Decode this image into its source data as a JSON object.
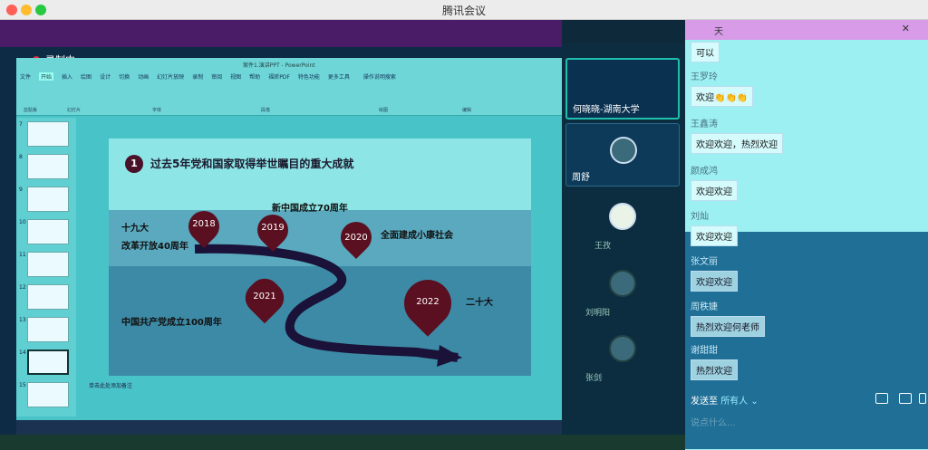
{
  "window": {
    "title": "腾讯会议"
  },
  "recording": {
    "label": "录制中"
  },
  "powerpoint": {
    "title": "案件1.演讲PPT - PowerPoint",
    "tabs": [
      "文件",
      "开始",
      "插入",
      "绘图",
      "设计",
      "切换",
      "动画",
      "幻灯片放映",
      "录制",
      "审阅",
      "视图",
      "帮助",
      "福昕PDF",
      "特色功能",
      "更多工具"
    ],
    "tell_me": "操作说明搜索",
    "groups": [
      "剪贴板",
      "幻灯片",
      "字体",
      "段落",
      "绘图",
      "编辑"
    ],
    "thumbnail_numbers": [
      "7",
      "8",
      "9",
      "10",
      "11",
      "12",
      "13",
      "14",
      "15"
    ],
    "notes_hint": "单击此处添加备注"
  },
  "slide": {
    "number": "1",
    "heading": "过去5年党和国家取得举世瞩目的重大成就",
    "labels": {
      "congress19": "十九大",
      "reform40": "改革开放40周年",
      "prc70": "新中国成立70周年",
      "xiaokang": "全面建成小康社会",
      "party100": "中国共产党成立100周年",
      "congress20": "二十大"
    },
    "pins": [
      "2018",
      "2019",
      "2020",
      "2021",
      "2022"
    ]
  },
  "participants": {
    "video1": "何晓晓-湖南大学",
    "video2": "周舒",
    "others": [
      "王孜",
      "刘明阳",
      "张剑"
    ]
  },
  "chat": {
    "header_suffix": "天",
    "messages": [
      {
        "name": "",
        "text": "可以"
      },
      {
        "name": "王罗玲",
        "text": "欢迎👏👏👏"
      },
      {
        "name": "王鑫涛",
        "text": "欢迎欢迎，热烈欢迎"
      },
      {
        "name": "颜成鸿",
        "text": "欢迎欢迎"
      },
      {
        "name": "刘灿",
        "text": "欢迎欢迎"
      },
      {
        "name": "张文丽",
        "text": "欢迎欢迎"
      },
      {
        "name": "周秩婕",
        "text": "热烈欢迎何老师"
      },
      {
        "name": "谢甜甜",
        "text": "热烈欢迎"
      }
    ],
    "send_to_label": "发送至",
    "send_to_value": "所有人",
    "input_placeholder": "说点什么..."
  }
}
